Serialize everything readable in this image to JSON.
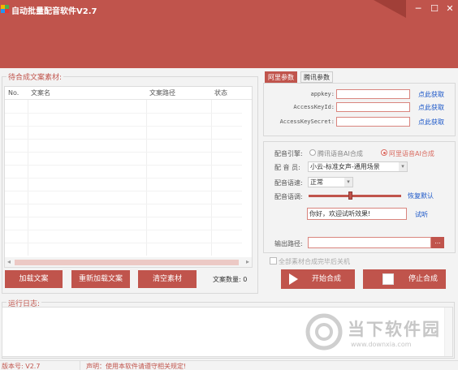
{
  "window": {
    "title": "自动批量配音软件V2.7",
    "controls": [
      "minimize-icon",
      "maximize-icon",
      "close-icon"
    ]
  },
  "left_panel": {
    "legend": "待合成文案素材:",
    "columns": [
      "No.",
      "文案名",
      "文案路径",
      "状态"
    ],
    "buttons": {
      "load": "加载文案",
      "reload": "重新加载文案",
      "clear": "清空素材"
    },
    "count_label": "文案数量:",
    "count_value": "0"
  },
  "params": {
    "tabs": [
      "阿里参数",
      "腾讯参数"
    ],
    "active_tab": "阿里参数",
    "fields": [
      {
        "label": "appkey:",
        "value": "",
        "link": "点此获取"
      },
      {
        "label": "AccessKeyId:",
        "value": "",
        "link": "点此获取"
      },
      {
        "label": "AccessKeySecret:",
        "value": "",
        "link": "点此获取"
      }
    ]
  },
  "voice": {
    "engine_label": "配音引擎:",
    "engines": [
      "腾讯语音AI合成",
      "阿里语音AI合成"
    ],
    "selected_engine": "阿里语音AI合成",
    "voicer_label": "配 音 员:",
    "voicer_value": "小云-标准女声-通用场景",
    "speed_label": "配音语速:",
    "speed_value": "正常",
    "tone_label": "配音语调:",
    "tone_level": 0.45,
    "restore_default": "恢复默认",
    "preview_text": "你好，欢迎试听效果!",
    "preview_link": "试听",
    "output_label": "输出路径:",
    "output_value": "",
    "browse": "...",
    "shutdown_label": "全部素材合成完毕后关机",
    "start": "开始合成",
    "stop": "停止合成"
  },
  "log": {
    "legend": "运行日志:"
  },
  "status": {
    "version": "版本号: V2.7",
    "notice": "声明：使用本软件请遵守相关规定!"
  },
  "watermark": {
    "brand": "当下软件园",
    "url": "www.downxia.com"
  },
  "colors": {
    "accent": "#c0544c",
    "link": "#1a56c8"
  }
}
